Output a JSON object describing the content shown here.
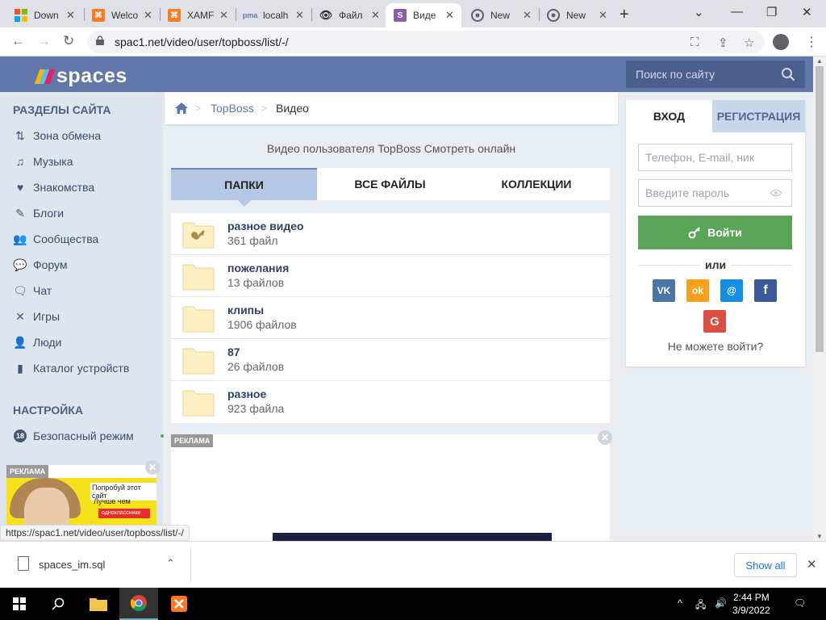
{
  "browser": {
    "tabs": [
      {
        "label": "Down",
        "favicon": "windows-icon",
        "color": "#f35325"
      },
      {
        "label": "Welco",
        "favicon": "xampp-icon",
        "color": "#fb7a24"
      },
      {
        "label": "XAMF",
        "favicon": "xampp-icon",
        "color": "#fb7a24"
      },
      {
        "label": "localh",
        "favicon": "phpmyadmin-icon",
        "color": "#6c78af"
      },
      {
        "label": "Файл",
        "favicon": "eye-icon",
        "color": "#333333"
      },
      {
        "label": "Виде",
        "favicon": "spaces-s-icon",
        "color": "#8a5fa8"
      },
      {
        "label": "New",
        "favicon": "chrome-icon",
        "color": "#5f6368"
      },
      {
        "label": "New",
        "favicon": "chrome-icon",
        "color": "#5f6368"
      }
    ],
    "new_tab": "+",
    "url": "spac1.net/video/user/topboss/list/-/",
    "status_url": "https://spac1.net/video/user/topboss/list/-/"
  },
  "site": {
    "logo_text": "spaces",
    "search_placeholder": "Поиск по сайту",
    "colors": {
      "header": "#5f77a9",
      "link": "#5b79ac",
      "green": "#5ba55b"
    }
  },
  "sidebar": {
    "sections_title": "РАЗДЕЛЫ САЙТА",
    "items": [
      {
        "label": "Зона обмена",
        "icon": "exchange-icon"
      },
      {
        "label": "Музыка",
        "icon": "music-icon"
      },
      {
        "label": "Знакомства",
        "icon": "heart-icon"
      },
      {
        "label": "Блоги",
        "icon": "pen-icon"
      },
      {
        "label": "Сообщества",
        "icon": "community-icon"
      },
      {
        "label": "Форум",
        "icon": "forum-icon"
      },
      {
        "label": "Чат",
        "icon": "chat-icon"
      },
      {
        "label": "Игры",
        "icon": "games-icon"
      },
      {
        "label": "Люди",
        "icon": "people-icon"
      },
      {
        "label": "Каталог устройств",
        "icon": "phone-icon"
      }
    ],
    "settings_title": "НАСТРОЙКА",
    "safe_mode": {
      "label": "Безопасный режим",
      "badge": "18"
    },
    "ad": {
      "tag": "РЕКЛАМА",
      "line1": "Попробуй этот сайт",
      "line2": "Лучше чем",
      "line3": "одноклассники"
    }
  },
  "main": {
    "breadcrumb": {
      "user": "TopBoss",
      "current": "Видео"
    },
    "subtitle": "Видео пользователя TopBoss Смотреть онлайн",
    "tabs": [
      "ПАПКИ",
      "ВСЕ ФАЙЛЫ",
      "КОЛЛЕКЦИИ"
    ],
    "folders": [
      {
        "name": "разное видео",
        "count": "361 файл",
        "locked": true
      },
      {
        "name": "пожелания",
        "count": "13 файлов",
        "locked": false
      },
      {
        "name": "клипы",
        "count": "1906 файлов",
        "locked": false
      },
      {
        "name": "87",
        "count": "26 файлов",
        "locked": false
      },
      {
        "name": "разное",
        "count": "923 файла",
        "locked": false
      }
    ],
    "ad_tag": "РЕКЛАМА"
  },
  "login": {
    "tab_login": "ВХОД",
    "tab_register": "РЕГИСТРАЦИЯ",
    "username_placeholder": "Телефон, E-mail, ник",
    "password_placeholder": "Введите пароль",
    "submit": "Войти",
    "or": "или",
    "social": [
      {
        "label": "VK",
        "icon": "vk-icon",
        "color": "#4c75a3"
      },
      {
        "label": "ok",
        "icon": "odnoklassniki-icon",
        "color": "#f7a01d"
      },
      {
        "label": "@",
        "icon": "mailru-icon",
        "color": "#168de2"
      },
      {
        "label": "f",
        "icon": "facebook-icon",
        "color": "#3b5998"
      },
      {
        "label": "G",
        "icon": "google-icon",
        "color": "#dc4e41"
      }
    ],
    "forgot": "Не можете войти?"
  },
  "downloads": {
    "file": "spaces_im.sql",
    "show_all": "Show all"
  },
  "taskbar": {
    "time": "2:44 PM",
    "date": "3/9/2022"
  }
}
